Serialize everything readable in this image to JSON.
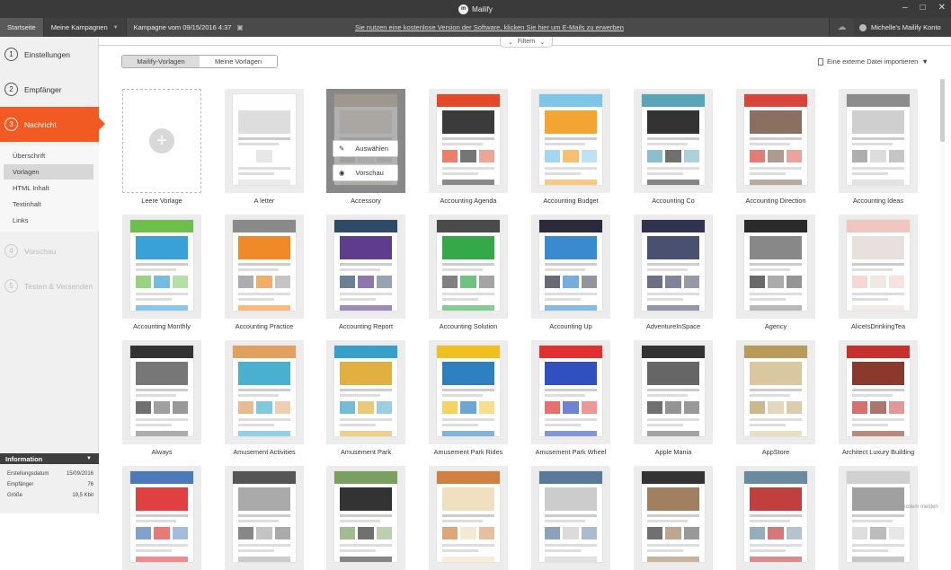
{
  "app": {
    "title": "Mailify",
    "logo": "m"
  },
  "nav": {
    "home": "Startseite",
    "campaigns": "Meine Kampagnen",
    "campaign_name": "Kampagne vom 09/15/2016 4:37",
    "promo": "Sie nutzen eine kostenlose Version der Software, klicken Sie hier um E-Mails zu erwerben",
    "account": "Michelle's Mailify Konto"
  },
  "filter": {
    "label": "Filtern"
  },
  "steps": [
    {
      "num": "1",
      "label": "Einstellungen"
    },
    {
      "num": "2",
      "label": "Empfänger"
    },
    {
      "num": "3",
      "label": "Nachricht"
    },
    {
      "num": "4",
      "label": "Vorschau"
    },
    {
      "num": "5",
      "label": "Testen & Versenden"
    }
  ],
  "substeps": [
    "Überschrift",
    "Vorlagen",
    "HTML Inhalt",
    "Textinhalt",
    "Links"
  ],
  "info": {
    "title": "Information",
    "rows": [
      {
        "k": "Erstellungsdatum",
        "v": "15/09/2016"
      },
      {
        "k": "Empfänger",
        "v": "76"
      },
      {
        "k": "Größe",
        "v": "19,5 Kbit"
      }
    ]
  },
  "tabs": [
    "Mailify-Vorlagen",
    "Meine Vorlagen"
  ],
  "import": {
    "label": "Eine externe Datei importieren"
  },
  "hover": {
    "select": "Auswählen",
    "preview": "Vorschau"
  },
  "templates": [
    {
      "name": "Leere Vorlage",
      "kind": "blank"
    },
    {
      "name": "A letter",
      "accent": "#ffffff",
      "alt": "#dddddd"
    },
    {
      "name": "Accessory",
      "accent": "#c7b89e",
      "alt": "#e9e2d4"
    },
    {
      "name": "Accounting Agenda",
      "accent": "#e2492b",
      "alt": "#3b3b3b"
    },
    {
      "name": "Accounting Budget",
      "accent": "#7ec6e8",
      "alt": "#f3a533"
    },
    {
      "name": "Accounting Co",
      "accent": "#5aa4b8",
      "alt": "#333333"
    },
    {
      "name": "Accounting Direction",
      "accent": "#d9453c",
      "alt": "#8a7060"
    },
    {
      "name": "Accounting Ideas",
      "accent": "#8c8c8c",
      "alt": "#cfcfcf"
    },
    {
      "name": "Accounting Monthly",
      "accent": "#6cc04a",
      "alt": "#3aa0d8"
    },
    {
      "name": "Accounting Practice",
      "accent": "#8a8a8a",
      "alt": "#f08a28"
    },
    {
      "name": "Accounting Report",
      "accent": "#2d4a66",
      "alt": "#5f3c8c"
    },
    {
      "name": "Accounting Solution",
      "accent": "#4a4a4a",
      "alt": "#35a84a"
    },
    {
      "name": "Accounting Up",
      "accent": "#2a2a3a",
      "alt": "#3a8ad0"
    },
    {
      "name": "AdventureInSpace",
      "accent": "#2f3350",
      "alt": "#4a5070"
    },
    {
      "name": "Agency",
      "accent": "#2a2a2a",
      "alt": "#888888"
    },
    {
      "name": "AliceIsDrinkingTea",
      "accent": "#f2c6c0",
      "alt": "#e8e0dc"
    },
    {
      "name": "Always",
      "accent": "#333333",
      "alt": "#777777"
    },
    {
      "name": "Amusement Activities",
      "accent": "#e0a060",
      "alt": "#4ab0d0"
    },
    {
      "name": "Amusement Park",
      "accent": "#36a0c8",
      "alt": "#e0b040"
    },
    {
      "name": "Amusement Park Rides",
      "accent": "#f0c020",
      "alt": "#3080c0"
    },
    {
      "name": "Amusement Park Wheel",
      "accent": "#e03030",
      "alt": "#3050c0"
    },
    {
      "name": "Apple Mania",
      "accent": "#333333",
      "alt": "#666666"
    },
    {
      "name": "AppStore",
      "accent": "#b89a5a",
      "alt": "#d8c8a0"
    },
    {
      "name": "Architect Luxury Building",
      "accent": "#c83030",
      "alt": "#8a3a2a"
    },
    {
      "name": "",
      "accent": "#4a7ab8",
      "alt": "#e04040"
    },
    {
      "name": "",
      "accent": "#555555",
      "alt": "#aaaaaa"
    },
    {
      "name": "",
      "accent": "#7aa060",
      "alt": "#333333"
    },
    {
      "name": "",
      "accent": "#d08040",
      "alt": "#f0e0c0"
    },
    {
      "name": "",
      "accent": "#5a7a9a",
      "alt": "#cccccc"
    },
    {
      "name": "",
      "accent": "#333333",
      "alt": "#a08060"
    },
    {
      "name": "",
      "accent": "#6a8aa0",
      "alt": "#c04040"
    },
    {
      "name": "",
      "accent": "#d0d0d0",
      "alt": "#a0a0a0"
    }
  ],
  "footer": {
    "problem": "Problem melden"
  }
}
